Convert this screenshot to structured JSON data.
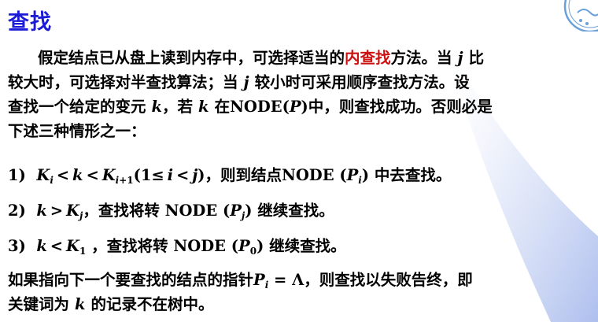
{
  "title": "查找",
  "intro": {
    "line1_a": "假定结点已从盘上读到内存中，可选择适当的",
    "line1_highlight": "内查找",
    "line1_b": "方法。当",
    "line1_var": "j",
    "line1_c": "比",
    "line2_a": "较大时，可选择对半查找算法；当",
    "line2_var": "j",
    "line2_b": "较小时可采用顺序查找方法。设",
    "line3_a": "查找一个给定的变元",
    "line3_var": "k",
    "line3_b": "，若",
    "line3_var2": "k",
    "line3_c": "在NODE(",
    "line3_var3": "P",
    "line3_d": ")中，则查找成功。否则必是",
    "line4": "下述三种情形之一："
  },
  "cases": [
    {
      "num": "1)",
      "text_a": "则到结点NODE (",
      "text_b": ") 中去查找。"
    },
    {
      "num": "2)",
      "text_a": "，查找将转 NODE (",
      "text_b": ") 继续查找。"
    },
    {
      "num": "3)",
      "text_a": "，查找将转 NODE (",
      "text_b": ") 继续查找。"
    }
  ],
  "outro": {
    "line1_a": "如果指向下一个要查找的结点的指针",
    "line1_b": "，则查找以失败告终，即",
    "line2_a": "关键词为",
    "line2_var": "k",
    "line2_b": "的记录不在树中。"
  },
  "colors": {
    "title": "#1c1cd8",
    "highlight": "#cc1111",
    "beam": "#c3d0f2"
  }
}
